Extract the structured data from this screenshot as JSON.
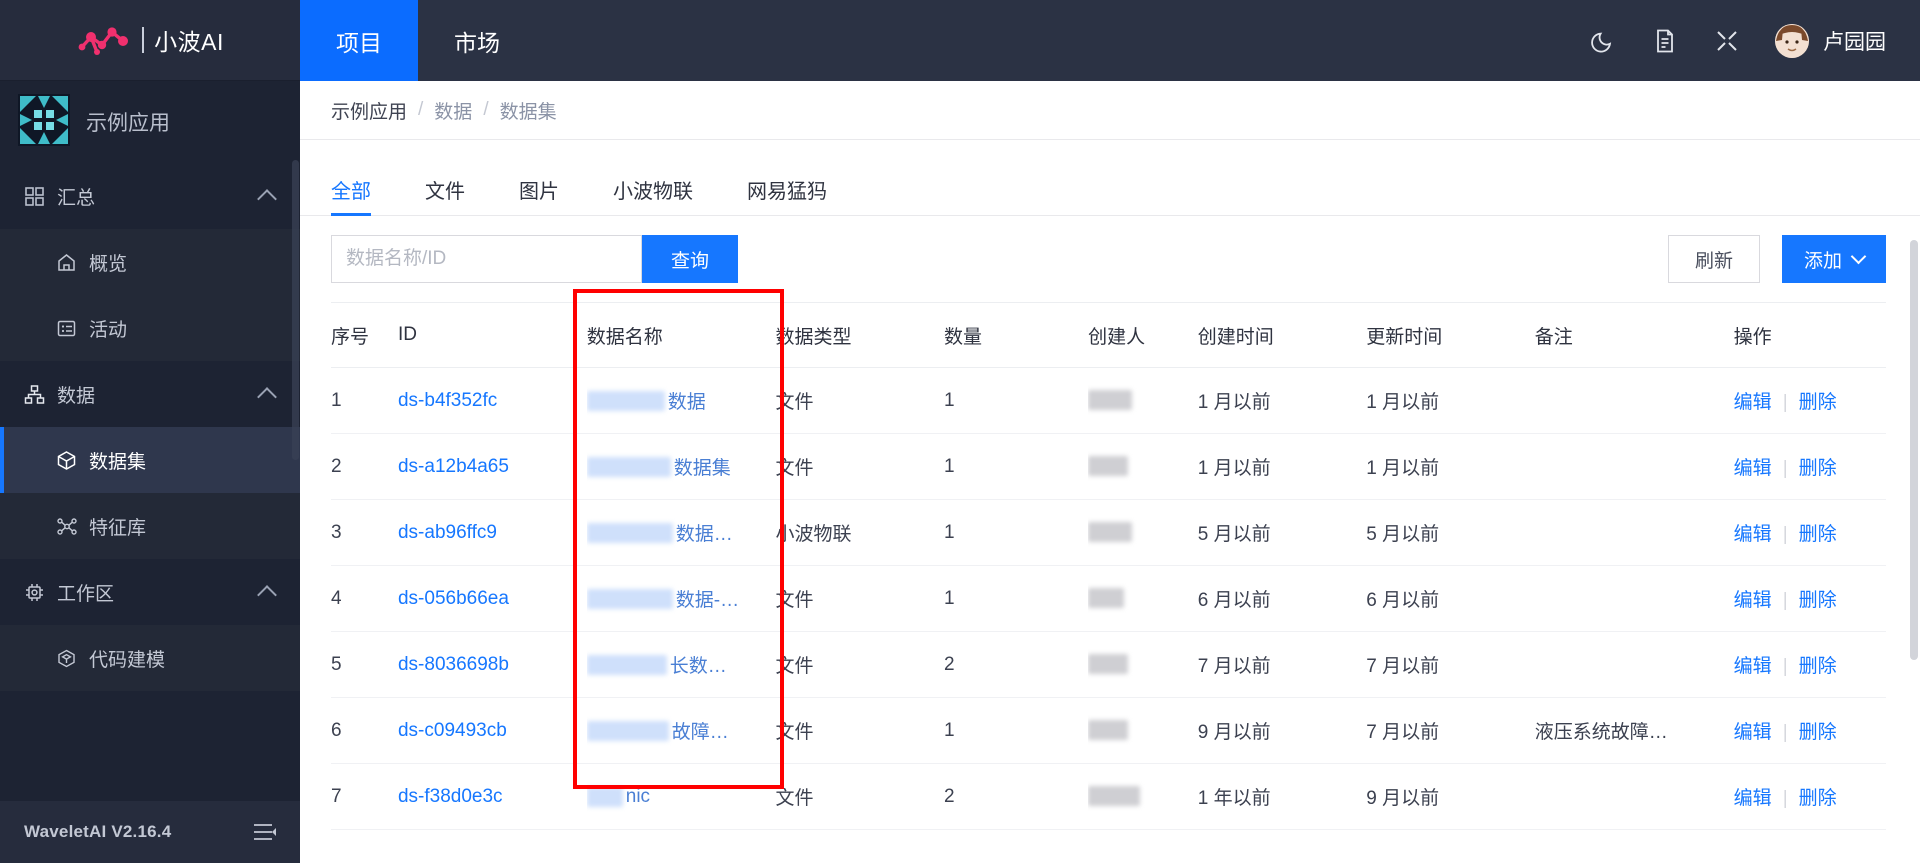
{
  "brand": {
    "name": "小波AI",
    "logo_icon": "wavelet-logo-icon"
  },
  "project": {
    "name": "示例应用",
    "icon": "project-tile-icon"
  },
  "sidebar": {
    "groups": [
      {
        "label": "汇总",
        "icon": "grid-icon",
        "chevron": "chevron-up-icon",
        "items": [
          {
            "label": "概览",
            "icon": "home-icon",
            "active": false
          },
          {
            "label": "活动",
            "icon": "activity-icon",
            "active": false
          }
        ]
      },
      {
        "label": "数据",
        "icon": "sitemap-icon",
        "chevron": "chevron-up-icon",
        "items": [
          {
            "label": "数据集",
            "icon": "cube-icon",
            "active": true
          },
          {
            "label": "特征库",
            "icon": "nodes-icon",
            "active": false
          }
        ]
      },
      {
        "label": "工作区",
        "icon": "chip-icon",
        "chevron": "chevron-up-icon",
        "items": [
          {
            "label": "代码建模",
            "icon": "cube-outline-icon",
            "active": false
          }
        ]
      }
    ],
    "footer": {
      "version": "WaveletAI V2.16.4",
      "collapse_icon": "collapse-menu-icon"
    }
  },
  "topbar": {
    "tabs": [
      {
        "label": "项目",
        "active": true
      },
      {
        "label": "市场",
        "active": false
      }
    ],
    "actions": [
      {
        "icon": "moon-icon",
        "name": "dark-mode-toggle"
      },
      {
        "icon": "document-icon",
        "name": "docs-button"
      },
      {
        "icon": "fullscreen-icon",
        "name": "fullscreen-button"
      }
    ],
    "user": {
      "name": "卢园园",
      "avatar_icon": "user-avatar"
    }
  },
  "breadcrumb": {
    "items": [
      "示例应用",
      "数据",
      "数据集"
    ],
    "separator": "/"
  },
  "filter_tabs": [
    {
      "label": "全部",
      "active": true
    },
    {
      "label": "文件",
      "active": false
    },
    {
      "label": "图片",
      "active": false
    },
    {
      "label": "小波物联",
      "active": false
    },
    {
      "label": "网易猛犸",
      "active": false
    }
  ],
  "toolbar": {
    "search_placeholder": "数据名称/ID",
    "search_value": "",
    "search_button": "查询",
    "refresh_button": "刷新",
    "add_button": "添加",
    "add_caret_icon": "chevron-down-icon"
  },
  "table": {
    "columns": [
      "序号",
      "ID",
      "数据名称",
      "数据类型",
      "数量",
      "创建人",
      "创建时间",
      "更新时间",
      "备注",
      "操作"
    ],
    "rows": [
      {
        "index": "1",
        "id": "ds-b4f352fc",
        "name_redacted": true,
        "name_redact_width": 78,
        "name_tail": "数据",
        "type": "文件",
        "count": "1",
        "owner_redacted": true,
        "owner_redact_width": 44,
        "created": "1 月以前",
        "updated": "1 月以前",
        "note": "",
        "edit": "编辑",
        "delete": "删除"
      },
      {
        "index": "2",
        "id": "ds-a12b4a65",
        "name_redacted": true,
        "name_redact_width": 84,
        "name_tail": "数据集",
        "type": "文件",
        "count": "1",
        "owner_redacted": true,
        "owner_redact_width": 40,
        "created": "1 月以前",
        "updated": "1 月以前",
        "note": "",
        "edit": "编辑",
        "delete": "删除"
      },
      {
        "index": "3",
        "id": "ds-ab96ffc9",
        "name_redacted": true,
        "name_redact_width": 86,
        "name_tail": "数据…",
        "type": "小波物联",
        "count": "1",
        "owner_redacted": true,
        "owner_redact_width": 44,
        "created": "5 月以前",
        "updated": "5 月以前",
        "note": "",
        "edit": "编辑",
        "delete": "删除"
      },
      {
        "index": "4",
        "id": "ds-056b66ea",
        "name_redacted": true,
        "name_redact_width": 86,
        "name_tail": "数据-…",
        "type": "文件",
        "count": "1",
        "owner_redacted": true,
        "owner_redact_width": 36,
        "created": "6 月以前",
        "updated": "6 月以前",
        "note": "",
        "edit": "编辑",
        "delete": "删除"
      },
      {
        "index": "5",
        "id": "ds-8036698b",
        "name_redacted": true,
        "name_redact_width": 80,
        "name_tail": "长数…",
        "type": "文件",
        "count": "2",
        "owner_redacted": true,
        "owner_redact_width": 40,
        "created": "7 月以前",
        "updated": "7 月以前",
        "note": "",
        "edit": "编辑",
        "delete": "删除"
      },
      {
        "index": "6",
        "id": "ds-c09493cb",
        "name_redacted": true,
        "name_redact_width": 82,
        "name_tail": "故障…",
        "type": "文件",
        "count": "1",
        "owner_redacted": true,
        "owner_redact_width": 40,
        "created": "9 月以前",
        "updated": "7 月以前",
        "note": "液压系统故障…",
        "edit": "编辑",
        "delete": "删除"
      },
      {
        "index": "7",
        "id": "ds-f38d0e3c",
        "name_redacted": true,
        "name_redact_width": 36,
        "name_tail": "nic",
        "type": "文件",
        "count": "2",
        "owner_redacted": true,
        "owner_redact_width": 52,
        "created": "1 年以前",
        "updated": "9 月以前",
        "note": "",
        "edit": "编辑",
        "delete": "删除"
      }
    ]
  },
  "annotation": {
    "shape": "rectangle",
    "color": "#ff0000",
    "target_column": "数据名称"
  },
  "colors": {
    "sidebar_bg": "#1d2333",
    "topbar_bg": "#2b3244",
    "accent_blue": "#1677ff",
    "tab_active_blue": "#0b6cff",
    "brand_pink": "#f0306e",
    "project_teal": "#4fd5e0",
    "annotation_red": "#ff0000"
  }
}
